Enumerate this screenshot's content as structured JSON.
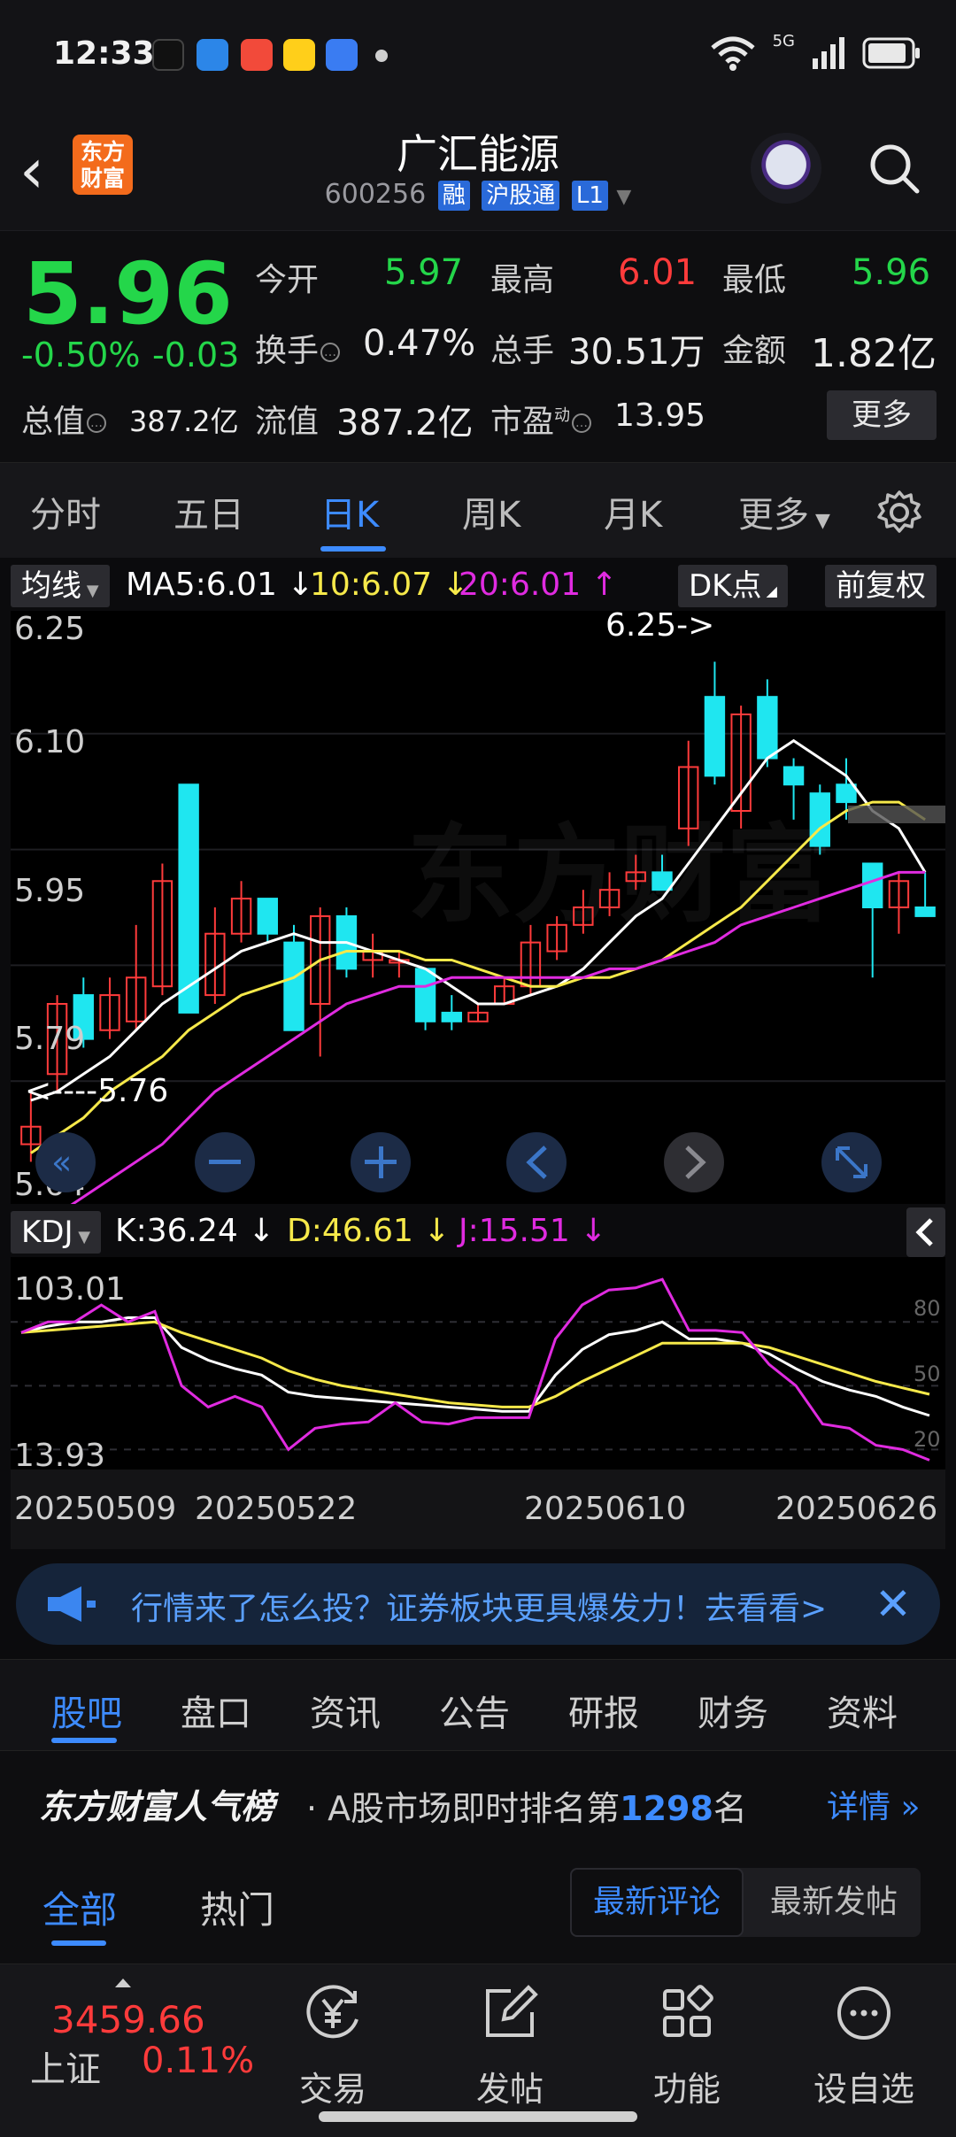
{
  "status": {
    "time": "12:33",
    "network": "5G"
  },
  "header": {
    "logo_text": "东方财富",
    "title": "广汇能源",
    "code": "600256",
    "tags": [
      "融",
      "沪股通",
      "L1"
    ]
  },
  "quote": {
    "price": "5.96",
    "change_pct": "-0.50%",
    "change": "-0.03",
    "open_label": "今开",
    "open": "5.97",
    "high_label": "最高",
    "high": "6.01",
    "low_label": "最低",
    "low": "5.96",
    "turnover_label": "换手",
    "turnover": "0.47%",
    "volume_label": "总手",
    "volume": "30.51万",
    "amount_label": "金额",
    "amount": "1.82亿",
    "mktcap_label": "总值",
    "mktcap": "387.2亿",
    "float_label": "流值",
    "float": "387.2亿",
    "pe_label": "市盈",
    "pe_sup": "动",
    "pe": "13.95",
    "more": "更多"
  },
  "tabs": [
    "分时",
    "五日",
    "日K",
    "周K",
    "月K",
    "更多"
  ],
  "kline": {
    "indicator": "均线",
    "ma5": "MA5:6.01",
    "ma10": "10:6.07",
    "ma20": "20:6.01",
    "dk_label": "DK点",
    "adjust": "前复权",
    "yaxis": [
      "6.25",
      "6.10",
      "5.95",
      "5.79",
      "5.64"
    ],
    "max_note": "6.25->",
    "min_note": "<----5.76",
    "colors": {
      "up": "#ff3b3b",
      "down": "#1fe6f0",
      "ma5": "#ffffff",
      "ma10": "#f6e94a",
      "ma20": "#e02be0"
    }
  },
  "kdj": {
    "indicator": "KDJ",
    "k": "K:36.24",
    "d": "D:46.61",
    "j": "J:15.51",
    "ymax": "103.01",
    "ymin": "13.93",
    "levels": [
      "80",
      "50",
      "20"
    ],
    "dates": [
      "20250509",
      "20250522",
      "20250610",
      "20250626"
    ]
  },
  "chart_data": [
    {
      "type": "candlestick",
      "title": "",
      "ylim": [
        5.64,
        6.3
      ],
      "candles": [
        {
          "o": 5.7,
          "c": 5.72,
          "h": 5.76,
          "l": 5.68
        },
        {
          "o": 5.78,
          "c": 5.86,
          "h": 5.87,
          "l": 5.76
        },
        {
          "o": 5.87,
          "c": 5.82,
          "h": 5.89,
          "l": 5.81
        },
        {
          "o": 5.83,
          "c": 5.87,
          "h": 5.89,
          "l": 5.82
        },
        {
          "o": 5.84,
          "c": 5.89,
          "h": 5.95,
          "l": 5.83
        },
        {
          "o": 5.88,
          "c": 6.0,
          "h": 6.02,
          "l": 5.87
        },
        {
          "o": 6.11,
          "c": 5.85,
          "h": 6.11,
          "l": 5.85
        },
        {
          "o": 5.87,
          "c": 5.94,
          "h": 5.97,
          "l": 5.86
        },
        {
          "o": 5.94,
          "c": 5.98,
          "h": 6.0,
          "l": 5.93
        },
        {
          "o": 5.98,
          "c": 5.94,
          "h": 5.98,
          "l": 5.93
        },
        {
          "o": 5.93,
          "c": 5.83,
          "h": 5.95,
          "l": 5.83
        },
        {
          "o": 5.86,
          "c": 5.96,
          "h": 5.97,
          "l": 5.8
        },
        {
          "o": 5.96,
          "c": 5.9,
          "h": 5.97,
          "l": 5.89
        },
        {
          "o": 5.91,
          "c": 5.92,
          "h": 5.94,
          "l": 5.89
        },
        {
          "o": 5.91,
          "c": 5.91,
          "h": 5.92,
          "l": 5.89
        },
        {
          "o": 5.9,
          "c": 5.84,
          "h": 5.9,
          "l": 5.83
        },
        {
          "o": 5.85,
          "c": 5.84,
          "h": 5.87,
          "l": 5.83
        },
        {
          "o": 5.84,
          "c": 5.85,
          "h": 5.86,
          "l": 5.84
        },
        {
          "o": 5.86,
          "c": 5.88,
          "h": 5.89,
          "l": 5.86
        },
        {
          "o": 5.88,
          "c": 5.93,
          "h": 5.95,
          "l": 5.87
        },
        {
          "o": 5.92,
          "c": 5.95,
          "h": 5.96,
          "l": 5.91
        },
        {
          "o": 5.95,
          "c": 5.97,
          "h": 5.99,
          "l": 5.94
        },
        {
          "o": 5.97,
          "c": 5.99,
          "h": 6.01,
          "l": 5.96
        },
        {
          "o": 6.0,
          "c": 6.01,
          "h": 6.03,
          "l": 5.99
        },
        {
          "o": 6.01,
          "c": 5.99,
          "h": 6.03,
          "l": 5.99
        },
        {
          "o": 6.06,
          "c": 6.13,
          "h": 6.16,
          "l": 6.04
        },
        {
          "o": 6.21,
          "c": 6.12,
          "h": 6.25,
          "l": 6.11
        },
        {
          "o": 6.08,
          "c": 6.19,
          "h": 6.2,
          "l": 6.06
        },
        {
          "o": 6.21,
          "c": 6.14,
          "h": 6.23,
          "l": 6.13
        },
        {
          "o": 6.13,
          "c": 6.11,
          "h": 6.14,
          "l": 6.07
        },
        {
          "o": 6.1,
          "c": 6.04,
          "h": 6.11,
          "l": 6.03
        },
        {
          "o": 6.11,
          "c": 6.09,
          "h": 6.14,
          "l": 6.07
        },
        {
          "o": 6.02,
          "c": 5.97,
          "h": 6.02,
          "l": 5.89
        },
        {
          "o": 5.97,
          "c": 6.0,
          "h": 6.01,
          "l": 5.94
        },
        {
          "o": 5.97,
          "c": 5.96,
          "h": 6.01,
          "l": 5.96
        }
      ],
      "series": [
        {
          "name": "MA5",
          "values": [
            5.75,
            5.76,
            5.78,
            5.8,
            5.83,
            5.86,
            5.88,
            5.9,
            5.92,
            5.93,
            5.94,
            5.93,
            5.93,
            5.92,
            5.91,
            5.9,
            5.88,
            5.86,
            5.86,
            5.87,
            5.88,
            5.9,
            5.93,
            5.96,
            5.98,
            6.02,
            6.06,
            6.1,
            6.14,
            6.16,
            6.14,
            6.12,
            6.08,
            6.06,
            6.01
          ]
        },
        {
          "name": "MA10",
          "values": [
            5.69,
            5.71,
            5.73,
            5.76,
            5.78,
            5.8,
            5.83,
            5.85,
            5.87,
            5.88,
            5.89,
            5.91,
            5.92,
            5.92,
            5.92,
            5.91,
            5.91,
            5.9,
            5.89,
            5.88,
            5.88,
            5.89,
            5.89,
            5.9,
            5.91,
            5.93,
            5.95,
            5.97,
            6.0,
            6.03,
            6.06,
            6.08,
            6.09,
            6.09,
            6.07
          ]
        },
        {
          "name": "MA20",
          "values": [
            5.6,
            5.62,
            5.64,
            5.66,
            5.68,
            5.7,
            5.73,
            5.76,
            5.78,
            5.8,
            5.82,
            5.84,
            5.86,
            5.87,
            5.88,
            5.88,
            5.89,
            5.89,
            5.89,
            5.89,
            5.89,
            5.89,
            5.9,
            5.9,
            5.91,
            5.92,
            5.93,
            5.95,
            5.96,
            5.97,
            5.98,
            5.99,
            6.0,
            6.01,
            6.01
          ]
        }
      ]
    },
    {
      "type": "line",
      "title": "",
      "ylim": [
        13.93,
        103.01
      ],
      "series": [
        {
          "name": "K",
          "values": [
            75,
            78,
            80,
            80,
            82,
            82,
            68,
            62,
            58,
            55,
            47,
            45,
            44,
            43,
            42,
            41,
            40,
            39,
            38,
            38,
            55,
            67,
            74,
            76,
            80,
            72,
            72,
            70,
            65,
            58,
            52,
            48,
            45,
            40,
            36
          ]
        },
        {
          "name": "D",
          "values": [
            75,
            76,
            77,
            78,
            79,
            80,
            75,
            71,
            67,
            63,
            57,
            53,
            50,
            48,
            46,
            44,
            42,
            41,
            40,
            40,
            45,
            52,
            58,
            64,
            70,
            70,
            70,
            70,
            68,
            64,
            60,
            56,
            52,
            49,
            46
          ]
        },
        {
          "name": "J",
          "values": [
            75,
            80,
            80,
            88,
            80,
            85,
            50,
            40,
            45,
            40,
            20,
            30,
            32,
            33,
            42,
            33,
            32,
            35,
            35,
            35,
            72,
            88,
            95,
            96,
            100,
            76,
            76,
            75,
            60,
            50,
            32,
            30,
            22,
            20,
            15
          ]
        }
      ]
    }
  ],
  "banner": {
    "text": "行情来了怎么投？证券板块更具爆发力！去看看>"
  },
  "content_tabs": [
    "股吧",
    "盘口",
    "资讯",
    "公告",
    "研报",
    "财务",
    "资料"
  ],
  "rank": {
    "brand": "东方财富人气榜",
    "text_pre": "· A股市场即时排名第",
    "num": "1298",
    "text_post": "名",
    "detail": "详情"
  },
  "filter": {
    "tabs": [
      "全部",
      "热门"
    ],
    "seg": [
      "最新评论",
      "最新发帖"
    ]
  },
  "bottom": {
    "index_value": "3459.66",
    "index_name": "上证",
    "index_pct": "0.11%",
    "nav": [
      "交易",
      "发帖",
      "功能",
      "设自选"
    ]
  }
}
